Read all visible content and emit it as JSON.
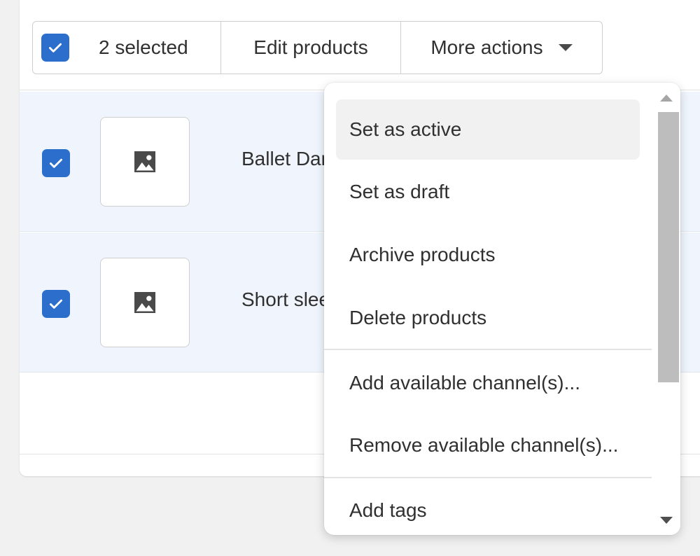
{
  "bulk_bar": {
    "selected_label": "2 selected",
    "edit_label": "Edit products",
    "more_label": "More actions"
  },
  "products": [
    {
      "name": "Ballet Dance Leotard",
      "checked": true
    },
    {
      "name": "Short sleeve t-shirt",
      "checked": true
    }
  ],
  "menu": {
    "items": [
      {
        "label": "Set as active"
      },
      {
        "label": "Set as draft"
      },
      {
        "label": "Archive products"
      },
      {
        "label": "Delete products"
      },
      {
        "label": "Add available channel(s)..."
      },
      {
        "label": "Remove available channel(s)..."
      },
      {
        "label": "Add tags"
      }
    ]
  },
  "colors": {
    "accent": "#2c6ecb",
    "selected_row_bg": "#f0f5fd",
    "menu_hover_bg": "#f1f1f1"
  },
  "icons": {
    "check": "checkmark-icon",
    "image_placeholder": "image-placeholder-icon",
    "caret": "caret-down-icon"
  }
}
